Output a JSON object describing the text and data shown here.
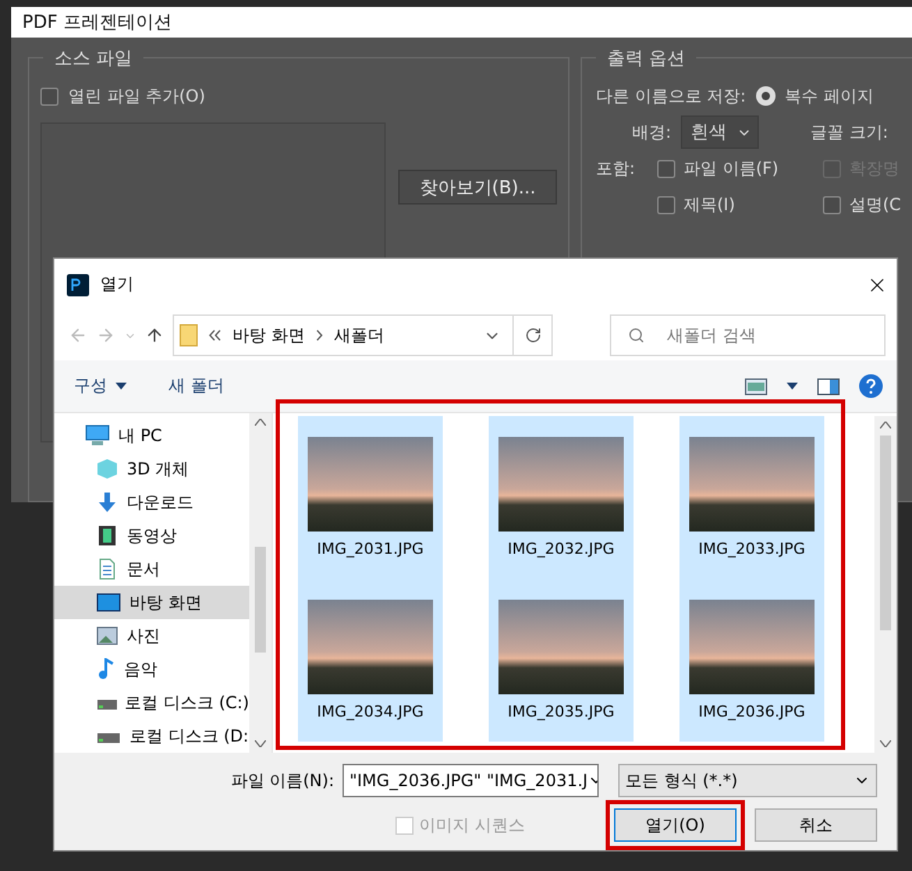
{
  "app_window": {
    "title": "PDF 프레젠테이션",
    "source": {
      "legend": "소스 파일",
      "add_open": {
        "label": "열린 파일 추가(O)",
        "checked": false
      },
      "browse": "찾아보기(B)..."
    },
    "output": {
      "legend": "출력 옵션",
      "save_as_label": "다른 이름으로 저장:",
      "save_as": {
        "label": "복수 페이지",
        "selected": true
      },
      "background_label": "배경:",
      "background": "흰색",
      "font_size_label": "글꼴 크기:",
      "include_label": "포함:",
      "include": [
        {
          "label": "파일 이름(F)",
          "checked": false,
          "disabled": false
        },
        {
          "label": "확장명",
          "checked": false,
          "disabled": true
        },
        {
          "label": "제목(I)",
          "checked": false,
          "disabled": false
        },
        {
          "label": "설명(C",
          "checked": false,
          "disabled": false
        }
      ]
    }
  },
  "open_dialog": {
    "title": "열기",
    "path": [
      "바탕 화면",
      "새폴더"
    ],
    "search": {
      "placeholder": "새폴더 검색"
    },
    "toolbar": {
      "organize": "구성",
      "new_folder": "새 폴더"
    },
    "nav": [
      {
        "label": "내 PC",
        "kind": "pc",
        "selected": false,
        "children": [
          {
            "label": "3D 개체",
            "kind": "cube",
            "selected": false
          },
          {
            "label": "다운로드",
            "kind": "download",
            "selected": false
          },
          {
            "label": "동영상",
            "kind": "video",
            "selected": false
          },
          {
            "label": "문서",
            "kind": "document",
            "selected": false
          },
          {
            "label": "바탕 화면",
            "kind": "desktop",
            "selected": true
          },
          {
            "label": "사진",
            "kind": "picture",
            "selected": false
          },
          {
            "label": "음악",
            "kind": "music",
            "selected": false
          },
          {
            "label": "로컬 디스크 (C:)",
            "kind": "disk",
            "selected": false
          },
          {
            "label": "로컬 디스크 (D:",
            "kind": "disk",
            "selected": false
          }
        ]
      }
    ],
    "files": [
      {
        "name": "IMG_2031.JPG",
        "selected": true
      },
      {
        "name": "IMG_2032.JPG",
        "selected": true
      },
      {
        "name": "IMG_2033.JPG",
        "selected": true
      },
      {
        "name": "IMG_2034.JPG",
        "selected": true
      },
      {
        "name": "IMG_2035.JPG",
        "selected": true
      },
      {
        "name": "IMG_2036.JPG",
        "selected": true
      }
    ],
    "file_name_label": "파일 이름(N):",
    "file_name": "\"IMG_2036.JPG\" \"IMG_2031.J",
    "file_type": "모든 형식 (*.*)",
    "sequence": {
      "label": "이미지 시퀀스",
      "checked": false,
      "disabled": true
    },
    "open_button": "열기(O)",
    "cancel_button": "취소"
  }
}
